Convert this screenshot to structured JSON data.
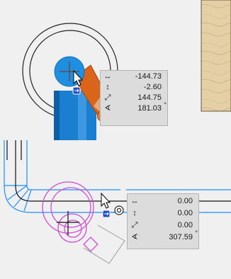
{
  "readout_top": {
    "rows": [
      {
        "icon": "horizontal-arrow-icon",
        "value": "-144.73",
        "unit": ""
      },
      {
        "icon": "vertical-arrow-icon",
        "value": "-2.60",
        "unit": ""
      },
      {
        "icon": "diagonal-arrow-icon",
        "value": "144.75",
        "unit": ""
      },
      {
        "icon": "angle-icon",
        "value": "181.03",
        "unit": "°"
      }
    ]
  },
  "readout_bottom": {
    "rows": [
      {
        "icon": "horizontal-arrow-icon",
        "value": "0.00",
        "unit": ""
      },
      {
        "icon": "vertical-arrow-icon",
        "value": "0.00",
        "unit": ""
      },
      {
        "icon": "diagonal-arrow-icon",
        "value": "0.00",
        "unit": ""
      },
      {
        "icon": "angle-icon",
        "value": "307.59",
        "unit": "°"
      }
    ]
  },
  "colors": {
    "background": "#f0f0f0",
    "wood": "#e4cfa6",
    "pipe_blue": "#1a7fd0",
    "pipe_orange": "#d9641a",
    "magenta": "#d24bd6",
    "pipe_outline": "#1e90ff"
  }
}
